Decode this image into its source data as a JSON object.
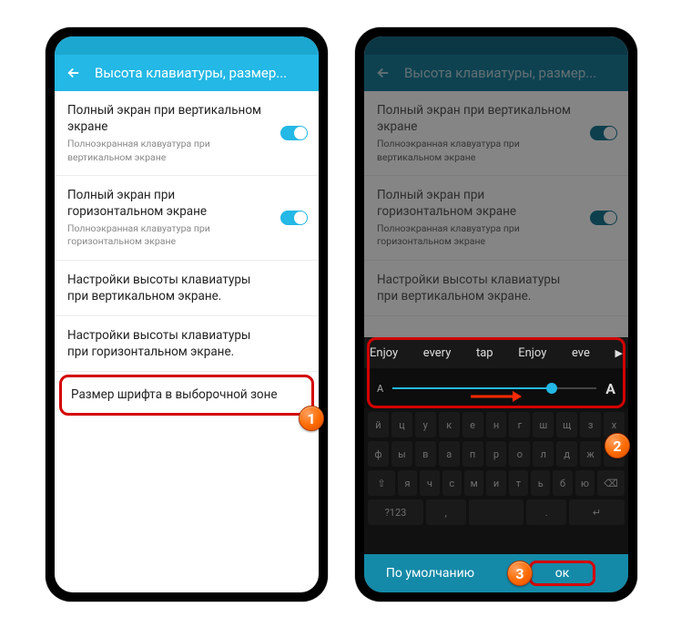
{
  "left": {
    "title": "Высота клавиатуры, размер...",
    "settings": [
      {
        "title": "Полный экран при вертикальном экране",
        "sub": "Полноэкранная клавуатура при вертикальном экране",
        "toggle": true
      },
      {
        "title": "Полный экран при горизонтальном экране",
        "sub": "Полноэкранная клавуатура при горизонтальном экране",
        "toggle": true
      },
      {
        "title": "Настройки высоты клавиатуры при вертикальном экране.",
        "sub": null,
        "toggle": false
      },
      {
        "title": "Настройки высоты клавиатуры при горизонтальном экране.",
        "sub": null,
        "toggle": false
      }
    ],
    "highlighted": "Размер шрифта в выборочной зоне"
  },
  "right": {
    "title": "Высота клавиатуры, размер...",
    "suggestions": [
      "Enjoy",
      "every",
      "tap",
      "Enjoy",
      "eve"
    ],
    "slider": {
      "smallLabel": "A",
      "bigLabel": "A",
      "position": 78
    },
    "keyrow1": [
      "й",
      "ц",
      "у",
      "к",
      "е",
      "н",
      "г",
      "ш",
      "щ",
      "з",
      "х"
    ],
    "keyrow2": [
      "ф",
      "ы",
      "в",
      "а",
      "п",
      "р",
      "о",
      "л",
      "д",
      "ж",
      "э"
    ],
    "keyrow3": [
      "⇧",
      "я",
      "ч",
      "с",
      "м",
      "и",
      "т",
      "ь",
      "б",
      "ю",
      "⌫"
    ],
    "keyrow4": [
      "?123",
      ",",
      "   ",
      ".",
      "↵"
    ],
    "buttons": {
      "default": "По умолчанию",
      "ok": "ок"
    }
  },
  "badges": {
    "b1": "1",
    "b2": "2",
    "b3": "3"
  }
}
